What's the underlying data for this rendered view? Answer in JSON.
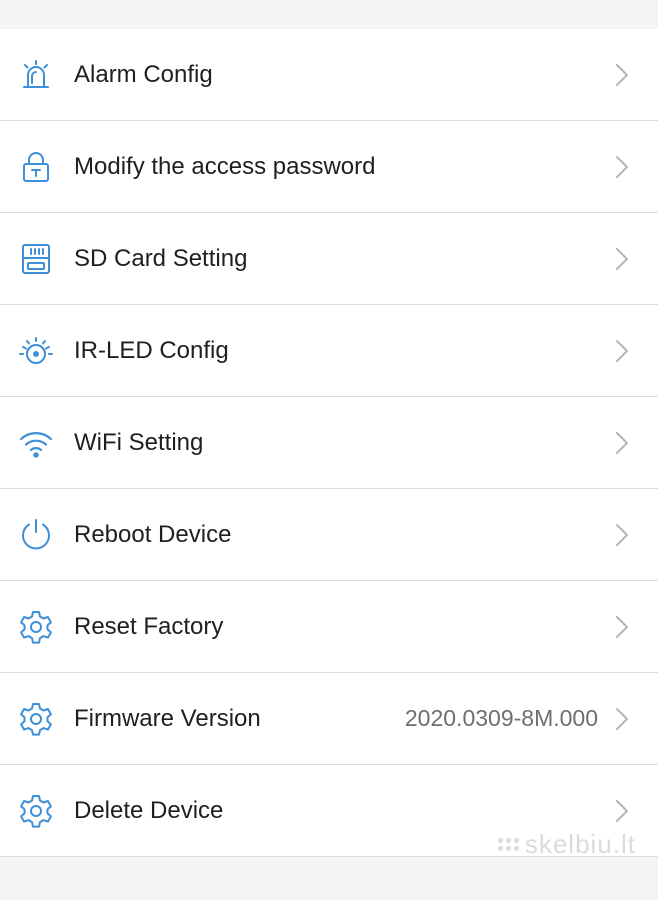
{
  "colors": {
    "accent": "#3d8fd9",
    "text": "#1f1f1f",
    "secondary_text": "#6e6e6e",
    "chevron": "#b5b5b5",
    "divider": "#dcdcdc",
    "background": "#f4f4f4"
  },
  "menu": {
    "items": [
      {
        "label": "Alarm Config",
        "icon": "alarm-icon"
      },
      {
        "label": "Modify the access password",
        "icon": "lock-icon"
      },
      {
        "label": "SD Card Setting",
        "icon": "sd-card-icon"
      },
      {
        "label": "IR-LED Config",
        "icon": "ir-led-icon"
      },
      {
        "label": "WiFi Setting",
        "icon": "wifi-icon"
      },
      {
        "label": "Reboot Device",
        "icon": "power-icon"
      },
      {
        "label": "Reset Factory",
        "icon": "gear-icon"
      },
      {
        "label": "Firmware Version",
        "icon": "gear-icon",
        "value": "2020.0309-8M.000"
      },
      {
        "label": "Delete Device",
        "icon": "gear-icon"
      }
    ]
  },
  "watermark": {
    "text": "skelbiu.lt"
  }
}
